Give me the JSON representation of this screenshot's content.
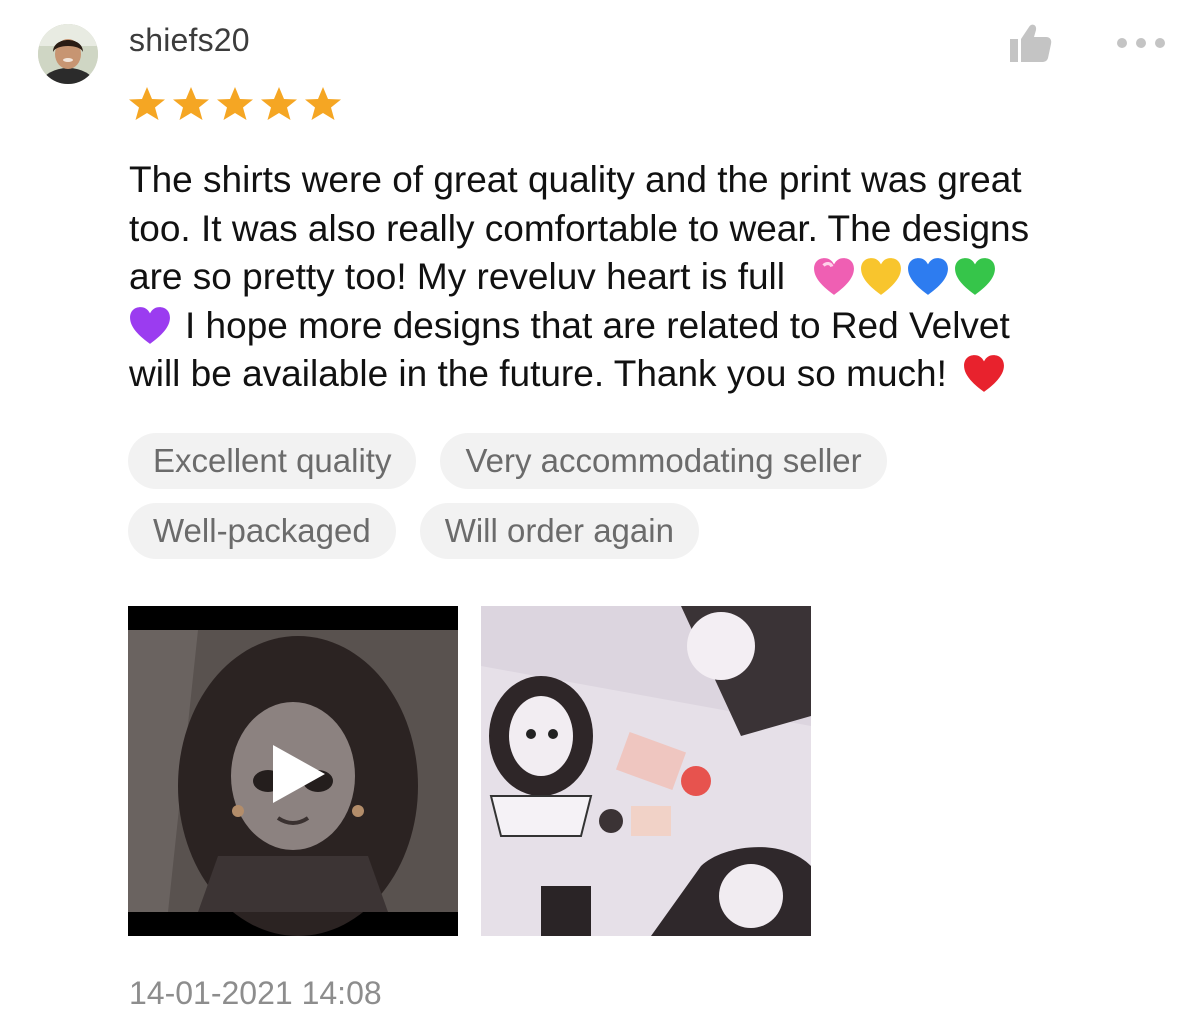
{
  "review": {
    "username": "shiefs20",
    "rating": 5,
    "text_lines": [
      "The shirts were of great quality and the print was great",
      "too. It was also really comfortable to wear. The designs",
      "are so pretty too! My reveluv heart is full",
      "I hope more designs that are related to Red Velvet",
      "will be available in the future. Thank you so much!"
    ],
    "tags": [
      "Excellent quality",
      "Very accommodating seller",
      "Well-packaged",
      "Will order again"
    ],
    "timestamp": "14-01-2021 14:08"
  },
  "icons": {
    "like": "thumbs-up-icon",
    "more": "more-options-icon",
    "play": "play-icon",
    "hearts": [
      "pink-heart",
      "yellow-heart",
      "blue-heart",
      "green-heart",
      "purple-heart",
      "red-heart"
    ]
  },
  "colors": {
    "star": "#f5a623",
    "tag_bg": "#f2f2f2",
    "tag_text": "#6b6b6b",
    "timestamp": "#8d8d8d"
  }
}
